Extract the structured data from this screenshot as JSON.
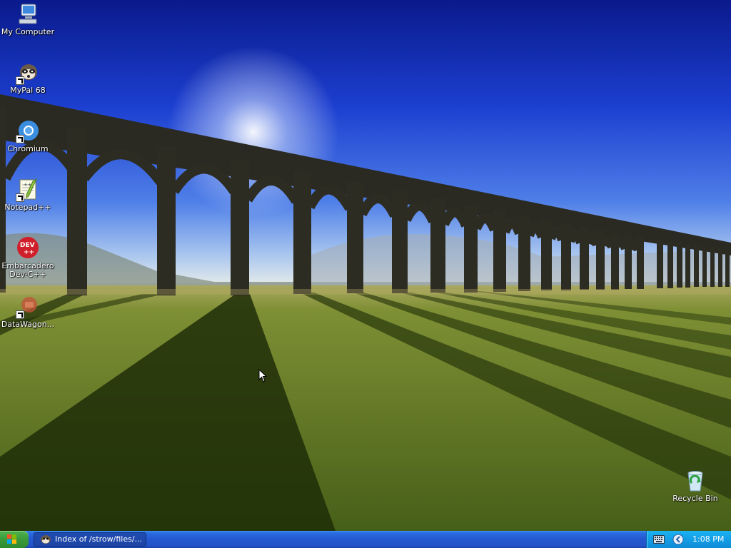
{
  "desktop": {
    "icons": [
      {
        "label": "My Computer",
        "icon": "computer-icon"
      },
      {
        "label": "MyPal 68",
        "icon": "raccoon-browser-icon"
      },
      {
        "label": "Chromium",
        "icon": "chromium-icon"
      },
      {
        "label": "Notepad++",
        "icon": "notepad-plus-plus-icon"
      },
      {
        "label": "Embarcadero Dev-C++",
        "icon": "dev-cpp-icon",
        "badge": "DEV ++"
      },
      {
        "label": "DataWagon...",
        "icon": "datawagon-icon"
      },
      {
        "label": "Recycle Bin",
        "icon": "recycle-bin-icon"
      }
    ]
  },
  "taskbar": {
    "start_icon": "windows-flag-icon",
    "task_item": {
      "label": "Index of /strow/files/...",
      "icon": "browser-window-icon"
    },
    "tray": {
      "keyboard_icon": "keyboard-icon",
      "arrow_icon": "show-hidden-icons-icon",
      "clock": "1:08 PM"
    }
  },
  "colors": {
    "taskbar": "#2457cf",
    "tray": "#139ee6",
    "start": "#3a9a3a"
  }
}
